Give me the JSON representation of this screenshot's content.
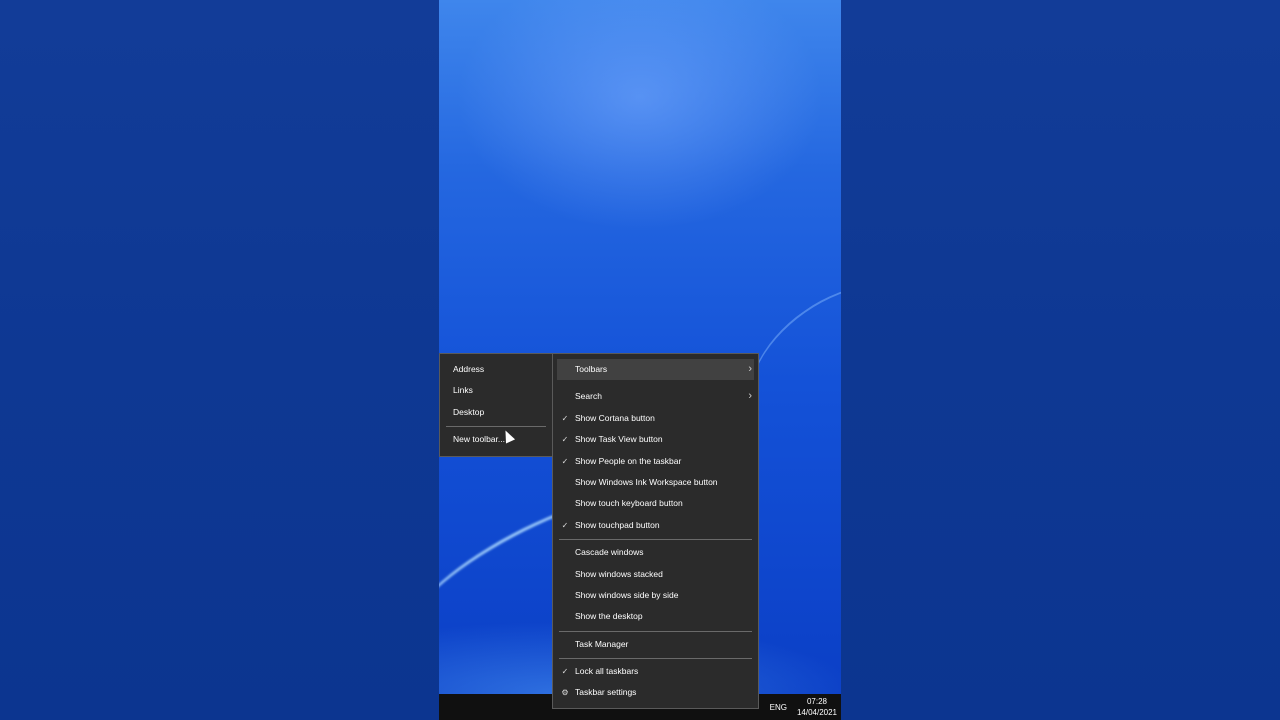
{
  "submenu": {
    "items": [
      {
        "label": "Address"
      },
      {
        "label": "Links"
      },
      {
        "label": "Desktop"
      },
      {
        "label": "New toolbar..."
      }
    ]
  },
  "context_menu": {
    "toolbars": "Toolbars",
    "search": "Search",
    "show_cortana": "Show Cortana button",
    "show_task_view": "Show Task View button",
    "show_people": "Show People on the taskbar",
    "show_ink": "Show Windows Ink Workspace button",
    "show_touch_keyboard": "Show touch keyboard button",
    "show_touchpad": "Show touchpad button",
    "cascade": "Cascade windows",
    "stacked": "Show windows stacked",
    "side_by_side": "Show windows side by side",
    "show_desktop": "Show the desktop",
    "task_manager": "Task Manager",
    "lock_taskbars": "Lock all taskbars",
    "taskbar_settings": "Taskbar settings"
  },
  "icons": {
    "check": "✓",
    "chevron": "›",
    "gear": "⚙"
  },
  "tray": {
    "language": "ENG",
    "time": "07:28",
    "date": "14/04/2021"
  }
}
